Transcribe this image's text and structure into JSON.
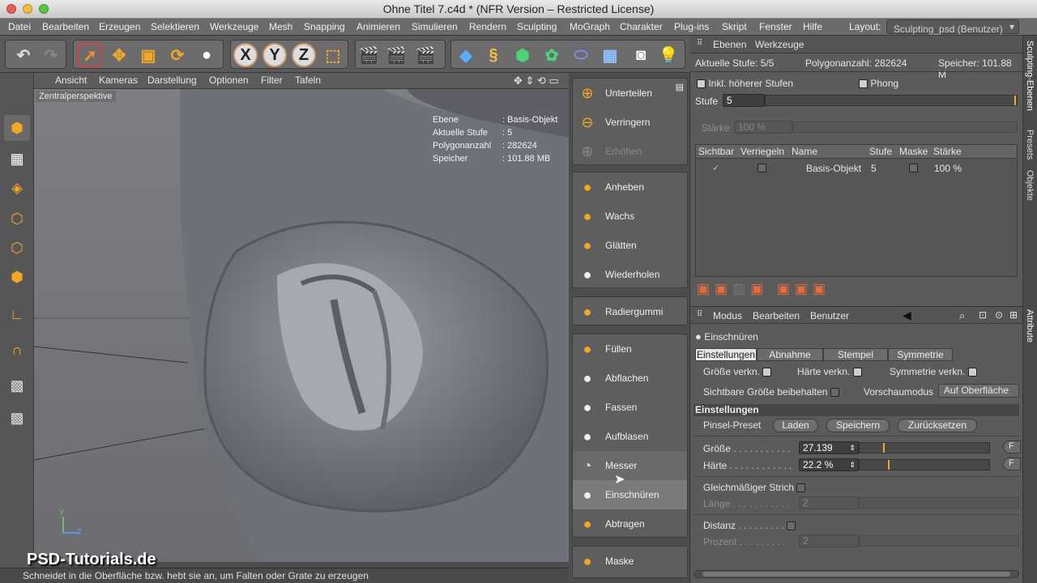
{
  "window": {
    "title": "Ohne Titel 7.c4d * (NFR Version – Restricted License)"
  },
  "menu": {
    "items": [
      "Datei",
      "Bearbeiten",
      "Erzeugen",
      "Selektieren",
      "Werkzeuge",
      "Mesh",
      "Snapping",
      "Animieren",
      "Simulieren",
      "Rendern",
      "Sculpting",
      "MoGraph",
      "Charakter",
      "Plug-ins",
      "Skript",
      "Fenster",
      "Hilfe"
    ],
    "layout_label": "Layout:",
    "layout_value": "Sculpting_psd (Benutzer)"
  },
  "viewport": {
    "menu": [
      "Ansicht",
      "Kameras",
      "Darstellung",
      "Optionen",
      "Filter",
      "Tafeln"
    ],
    "label": "Zentralperspektive",
    "hud": [
      [
        "Ebene",
        ": Basis-Objekt"
      ],
      [
        "Aktuelle Stufe",
        ": 5"
      ],
      [
        "Polygonanzahl",
        ": 282624"
      ],
      [
        "Speicher",
        ": 101.88 MB"
      ]
    ],
    "axis_y": "Y",
    "axis_z": "Z"
  },
  "status": "Schneidet in die Oberfläche bzw. hebt sie an, um Falten oder Grate zu erzeugen",
  "watermark": "PSD-Tutorials.de",
  "brushes": {
    "g1": [
      "Unterteilen",
      "Verringern",
      "Erhöhen"
    ],
    "g2": [
      "Anheben",
      "Wachs",
      "Glätten",
      "Wiederholen"
    ],
    "g3": [
      "Radiergummi"
    ],
    "g4": [
      "Füllen",
      "Abflachen",
      "Fassen",
      "Aufblasen",
      "Messer",
      "Einschnüren",
      "Abtragen"
    ],
    "g5": [
      "Maske"
    ]
  },
  "layers": {
    "menu": [
      "Ebenen",
      "Werkzeuge"
    ],
    "info_stufe": "Aktuelle Stufe: 5/5",
    "info_poly": "Polygonanzahl: 282624",
    "info_mem": "Speicher: 101.88 M",
    "incl": "Inkl. höherer Stufen",
    "phong": "Phong",
    "stufe_label": "Stufe",
    "stufe_value": "5",
    "staerke_label": "Stärke",
    "staerke_value": "100 %",
    "columns": [
      "Sichtbar",
      "Verriegeln",
      "Name",
      "Stufe",
      "Maske",
      "Stärke"
    ],
    "row": {
      "name": "Basis-Objekt",
      "stufe": "5",
      "staerke": "100 %"
    }
  },
  "attr": {
    "menu": [
      "Modus",
      "Bearbeiten",
      "Benutzer"
    ],
    "tool": "Einschnüren",
    "tabs": [
      "Einstellungen",
      "Abnahme",
      "Stempel",
      "Symmetrie"
    ],
    "groesse_verkn": "Größe verkn.",
    "haerte_verkn": "Härte verkn.",
    "sym_verkn": "Symmetrie verkn.",
    "sichtbare": "Sichtbare Größe beibehalten",
    "vorschau_label": "Vorschaumodus",
    "vorschau_value": "Auf Oberfläche",
    "section": "Einstellungen",
    "preset": "Pinsel-Preset",
    "btn_laden": "Laden",
    "btn_speichern": "Speichern",
    "btn_reset": "Zurücksetzen",
    "groesse_label": "Größe",
    "groesse_value": "27.139",
    "groesse_frac": 0.18,
    "haerte_label": "Härte",
    "haerte_value": "22.2 %",
    "haerte_frac": 0.22,
    "strich": "Gleichmäßiger Strich",
    "laenge": "Länge",
    "laenge_value": "2",
    "distanz": "Distanz",
    "prozent": "Prozent",
    "prozent_value": "2"
  },
  "side_tabs": [
    "Sculpting-Ebenen",
    "Presets",
    "Objekte",
    "Attribute"
  ]
}
